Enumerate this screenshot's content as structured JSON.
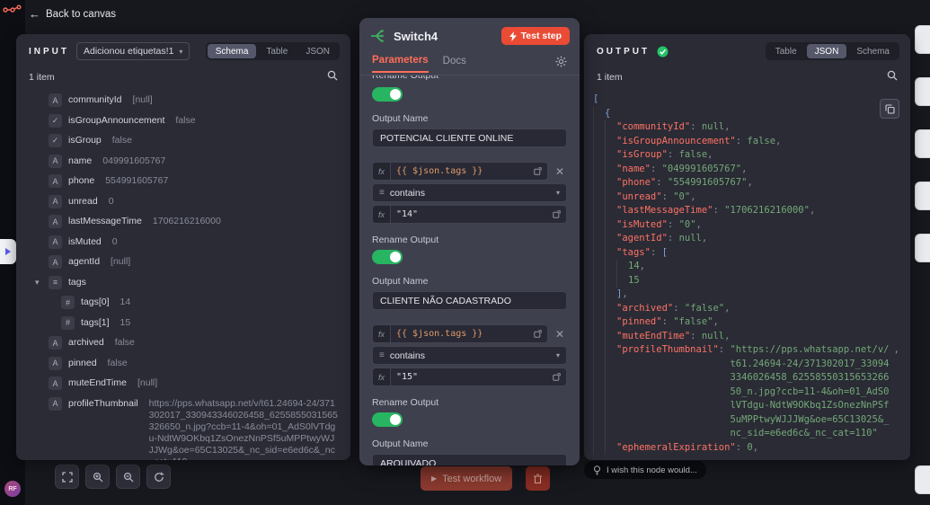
{
  "topbar": {
    "back_label": "Back to canvas"
  },
  "sidebar": {
    "avatar_initials": "RF"
  },
  "canvas": {
    "test_workflow_label": "Test workflow",
    "feedback_label": "I wish this node would..."
  },
  "input_panel": {
    "label": "INPUT",
    "source": "Adicionou etiquetas!1",
    "tabs": [
      "Schema",
      "Table",
      "JSON"
    ],
    "active_tab": "Schema",
    "items_count": "1 item",
    "fields": [
      {
        "type": "string",
        "name": "communityId",
        "value": "[null]",
        "indent": 0
      },
      {
        "type": "boolean",
        "name": "isGroupAnnouncement",
        "value": "false",
        "indent": 0
      },
      {
        "type": "boolean",
        "name": "isGroup",
        "value": "false",
        "indent": 0
      },
      {
        "type": "string",
        "name": "name",
        "value": "049991605767",
        "indent": 0
      },
      {
        "type": "string",
        "name": "phone",
        "value": "554991605767",
        "indent": 0
      },
      {
        "type": "string",
        "name": "unread",
        "value": "0",
        "indent": 0
      },
      {
        "type": "string",
        "name": "lastMessageTime",
        "value": "1706216216000",
        "indent": 0
      },
      {
        "type": "string",
        "name": "isMuted",
        "value": "0",
        "indent": 0
      },
      {
        "type": "string",
        "name": "agentId",
        "value": "[null]",
        "indent": 0
      },
      {
        "type": "array",
        "name": "tags",
        "value": "",
        "indent": 0,
        "expandable": true
      },
      {
        "type": "number",
        "name": "tags[0]",
        "value": "14",
        "indent": 1
      },
      {
        "type": "number",
        "name": "tags[1]",
        "value": "15",
        "indent": 1
      },
      {
        "type": "string",
        "name": "archived",
        "value": "false",
        "indent": 0
      },
      {
        "type": "string",
        "name": "pinned",
        "value": "false",
        "indent": 0
      },
      {
        "type": "string",
        "name": "muteEndTime",
        "value": "[null]",
        "indent": 0
      },
      {
        "type": "string",
        "name": "profileThumbnail",
        "value": "https://pps.whatsapp.net/v/t61.24694-24/371302017_330943346026458_6255855031565326650_n.jpg?ccb=11-4&oh=01_AdS0lVTdgu-NdtW9OKbq1ZsOnezNnPSf5uMPPtwyWJJJWg&oe=65C13025&_nc_sid=e6ed6c&_nc_cat=110",
        "indent": 0
      }
    ]
  },
  "node_panel": {
    "title": "Switch4",
    "test_step_label": "Test step",
    "tabs": {
      "parameters": "Parameters",
      "docs": "Docs"
    },
    "fx_label": "fx",
    "rename_output_label": "Rename Output",
    "output_name_label": "Output Name",
    "rules": [
      {
        "output_name": "POTENCIAL CLIENTE ONLINE"
      },
      {
        "expression": "{{ $json.tags }}",
        "operator": "contains",
        "value": "\"14\"",
        "output_name": "CLIENTE NÃO CADASTRADO"
      },
      {
        "expression": "{{ $json.tags }}",
        "operator": "contains",
        "value": "\"15\"",
        "output_name": "ARQUIVADO"
      }
    ]
  },
  "output_panel": {
    "label": "OUTPUT",
    "tabs": [
      "Table",
      "JSON",
      "Schema"
    ],
    "active_tab": "JSON",
    "items_count": "1 item",
    "json_lines": [
      [
        0,
        [
          [
            "brk",
            "["
          ]
        ]
      ],
      [
        1,
        [
          [
            "brk",
            "{"
          ]
        ]
      ],
      [
        2,
        [
          [
            "key",
            "\"communityId\""
          ],
          [
            "punc",
            ": "
          ],
          [
            "lit",
            "null"
          ],
          [
            "punc",
            ","
          ]
        ]
      ],
      [
        2,
        [
          [
            "key",
            "\"isGroupAnnouncement\""
          ],
          [
            "punc",
            ": "
          ],
          [
            "lit",
            "false"
          ],
          [
            "punc",
            ","
          ]
        ]
      ],
      [
        2,
        [
          [
            "key",
            "\"isGroup\""
          ],
          [
            "punc",
            ": "
          ],
          [
            "lit",
            "false"
          ],
          [
            "punc",
            ","
          ]
        ]
      ],
      [
        2,
        [
          [
            "key",
            "\"name\""
          ],
          [
            "punc",
            ": "
          ],
          [
            "str",
            "\"049991605767\""
          ],
          [
            "punc",
            ","
          ]
        ]
      ],
      [
        2,
        [
          [
            "key",
            "\"phone\""
          ],
          [
            "punc",
            ": "
          ],
          [
            "str",
            "\"554991605767\""
          ],
          [
            "punc",
            ","
          ]
        ]
      ],
      [
        2,
        [
          [
            "key",
            "\"unread\""
          ],
          [
            "punc",
            ": "
          ],
          [
            "str",
            "\"0\""
          ],
          [
            "punc",
            ","
          ]
        ]
      ],
      [
        2,
        [
          [
            "key",
            "\"lastMessageTime\""
          ],
          [
            "punc",
            ": "
          ],
          [
            "str",
            "\"1706216216000\""
          ],
          [
            "punc",
            ","
          ]
        ]
      ],
      [
        2,
        [
          [
            "key",
            "\"isMuted\""
          ],
          [
            "punc",
            ": "
          ],
          [
            "str",
            "\"0\""
          ],
          [
            "punc",
            ","
          ]
        ]
      ],
      [
        2,
        [
          [
            "key",
            "\"agentId\""
          ],
          [
            "punc",
            ": "
          ],
          [
            "lit",
            "null"
          ],
          [
            "punc",
            ","
          ]
        ]
      ],
      [
        2,
        [
          [
            "key",
            "\"tags\""
          ],
          [
            "punc",
            ": "
          ],
          [
            "brk",
            "["
          ]
        ]
      ],
      [
        3,
        [
          [
            "num",
            "14"
          ],
          [
            "punc",
            ","
          ]
        ]
      ],
      [
        3,
        [
          [
            "num",
            "15"
          ]
        ]
      ],
      [
        2,
        [
          [
            "brk",
            "]"
          ],
          [
            "punc",
            ","
          ]
        ]
      ],
      [
        2,
        [
          [
            "key",
            "\"archived\""
          ],
          [
            "punc",
            ": "
          ],
          [
            "str",
            "\"false\""
          ],
          [
            "punc",
            ","
          ]
        ]
      ],
      [
        2,
        [
          [
            "key",
            "\"pinned\""
          ],
          [
            "punc",
            ": "
          ],
          [
            "str",
            "\"false\""
          ],
          [
            "punc",
            ","
          ]
        ]
      ],
      [
        2,
        [
          [
            "key",
            "\"muteEndTime\""
          ],
          [
            "punc",
            ": "
          ],
          [
            "lit",
            "null"
          ],
          [
            "punc",
            ","
          ]
        ]
      ],
      [
        2,
        [
          [
            "key",
            "\"profileThumbnail\""
          ],
          [
            "punc",
            ": "
          ],
          [
            "strwrap",
            "\"https://pps.whatsapp.net/v/t61.24694-24/371302017_330943346026458_6255855031565326650_n.jpg?ccb=11-4&oh=01_AdS0lVTdgu-NdtW9OKbq1ZsOnezNnPSf5uMPPtwyWJJJWg&oe=65C13025&_nc_sid=e6ed6c&_nc_cat=110\""
          ],
          [
            "punc",
            ","
          ]
        ]
      ],
      [
        2,
        [
          [
            "key",
            "\"ephemeralExpiration\""
          ],
          [
            "punc",
            ": "
          ],
          [
            "num",
            "0"
          ],
          [
            "punc",
            ","
          ]
        ]
      ]
    ]
  }
}
